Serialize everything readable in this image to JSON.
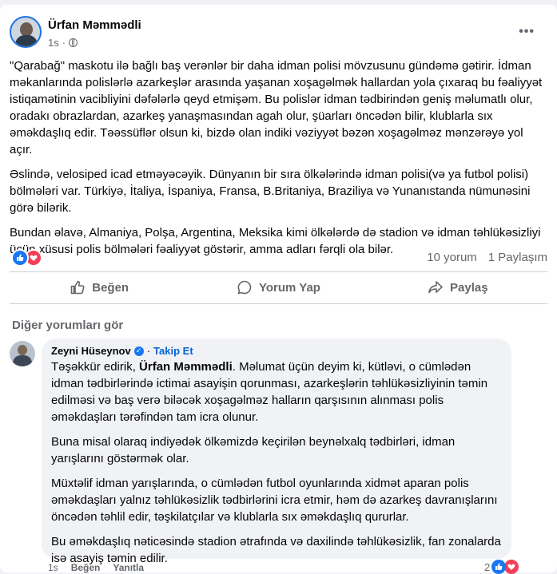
{
  "post": {
    "author": "Ürfan Məmmədli",
    "time": "1s",
    "paragraphs": [
      "\"Qarabağ\" maskotu ilə bağlı baş verənlər bir daha idman polisi mövzusunu gündəmə gətirir. İdman məkanlarında polislərlə azarkeşlər arasında yaşanan xoşagəlmək hallardan yola çıxaraq bu fəaliyyət istiqamətinin vacibliyini dəfələrlə qeyd etmişəm. Bu polislər idman tədbirindən geniş məlumatlı olur, oradakı obrazlardan, azarkeş yanaşmasından agah olur, şüarları öncədən bilir, klublarla sıx əməkdaşlıq edir. Təəssüflər olsun ki, bizdə olan indiki vəziyyət bəzən xoşagəlməz mənzərəyə yol açır.",
      "Əslində, velosiped icad etməyəcəyik. Dünyanın bir sıra ölkələrində idman polisi(və ya futbol polisi) bölmələri var. Türkiyə, İtaliya, İspaniya, Fransa, B.Britaniya, Braziliya və Yunanıstanda nümunəsini görə bilərik.",
      "Bundan əlavə, Almaniya, Polşa, Argentina, Meksika kimi ölkələrdə də stadion və idman təhlükəsizliyi üçün xüsusi polis bölmələri fəaliyyət göstərir, amma adları fərqli ola bilər."
    ],
    "comments_count": "10 yorum",
    "shares_count": "1 Paylaşım"
  },
  "actions": {
    "like": "Beğen",
    "comment": "Yorum Yap",
    "share": "Paylaş"
  },
  "see_more_comments": "Diğer yorumları gör",
  "comment": {
    "author": "Zeyni Hüseynov",
    "separator": "·",
    "follow": "Takip Et",
    "intro": "Təşəkkür edirik,",
    "mention": "Ürfan Məmmədli",
    "intro_rest": ". Məlumat üçün deyim ki, kütləvi, o cümlədən idman tədbirlərində ictimai asayişin qorunması, azarkeşlərin təhlükəsizliyinin təmin edilməsi və baş verə biləcək xoşagəlməz halların qarşısının alınması polis əməkdaşları tərəfindən tam icra olunur.",
    "paragraphs": [
      "Buna misal olaraq indiyədək ölkəmizdə keçirilən beynəlxalq tədbirləri, idman yarışlarını göstərmək olar.",
      "Müxtəlif idman yarışlarında, o cümlədən futbol oyunlarında xidmət aparan polis əməkdaşları yalnız təhlükəsizlik tədbirlərini icra etmir, həm də azarkeş davranışlarını öncədən təhlil edir, təşkilatçılar və klublarla sıx əməkdaşlıq qururlar.",
      "Bu əməkdaşlıq nəticəsində stadion ətrafında və daxilində təhlükəsizlik, fan zonalarda isə asayiş təmin edilir."
    ],
    "time": "1s",
    "like": "Beğen",
    "reply": "Yanıtla",
    "reaction_count": "2"
  },
  "colors": {
    "accent": "#1877f2",
    "love": "#f33e58",
    "secondary_text": "#65676b"
  }
}
